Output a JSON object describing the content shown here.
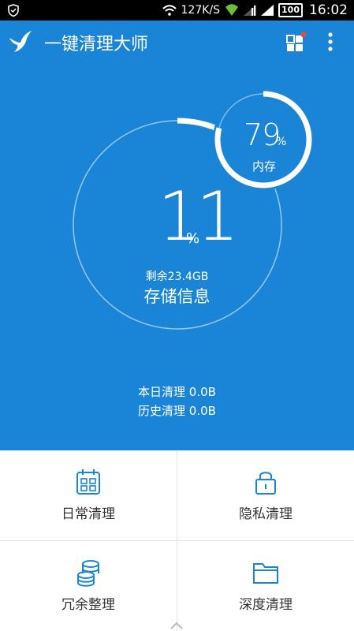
{
  "status_bar": {
    "network_speed": "127K/S",
    "battery": "100",
    "time": "16:02"
  },
  "app": {
    "title": "一键清理大师"
  },
  "memory": {
    "percent": "79",
    "unit": "%",
    "label": "内存",
    "fill_fraction": 0.79
  },
  "storage": {
    "percent": "11",
    "unit": "%",
    "remaining": "剩余23.4GB",
    "label": "存储信息",
    "fill_fraction": 0.11
  },
  "stats": {
    "today": "本日清理 0.0B",
    "history": "历史清理 0.0B"
  },
  "actions": {
    "daily": "日常清理",
    "privacy": "隐私清理",
    "redundant": "冗余整理",
    "deep": "深度清理"
  },
  "icons": {
    "shield": "shield-icon",
    "wifi": "wifi-icon",
    "signal": "signal-icon",
    "battery": "battery-icon",
    "logo": "bird-logo-icon",
    "apps": "apps-grid-icon",
    "more": "more-vertical-icon",
    "calendar": "calendar-icon",
    "lock": "lock-icon",
    "coins": "coin-stack-icon",
    "folder": "folder-icon",
    "caret": "chevron-up-icon"
  },
  "colors": {
    "primary": "#1a85d6",
    "notify_dot": "#e84a3c"
  }
}
